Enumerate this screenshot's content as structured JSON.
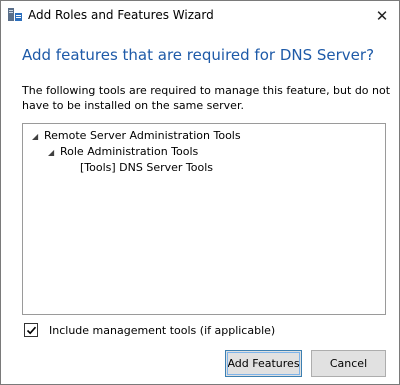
{
  "window": {
    "title": "Add Roles and Features Wizard",
    "icon": "server-manager-icon",
    "close_glyph": "✕"
  },
  "dialog": {
    "heading": "Add features that are required for DNS Server?",
    "description_line1": "The following tools are required to manage this feature, but do not",
    "description_line2": "have to be installed on the same server."
  },
  "tree": {
    "items": [
      {
        "label": "Remote Server Administration Tools",
        "expanded": true
      },
      {
        "label": "Role Administration Tools",
        "expanded": true
      },
      {
        "label": "[Tools] DNS Server Tools"
      }
    ]
  },
  "options": {
    "include_tools_label": "Include management tools (if applicable)",
    "include_tools_checked": true
  },
  "buttons": {
    "add_features": "Add Features",
    "cancel": "Cancel"
  },
  "colors": {
    "heading": "#1e5aa8",
    "focus_border": "#3c7fb1"
  }
}
